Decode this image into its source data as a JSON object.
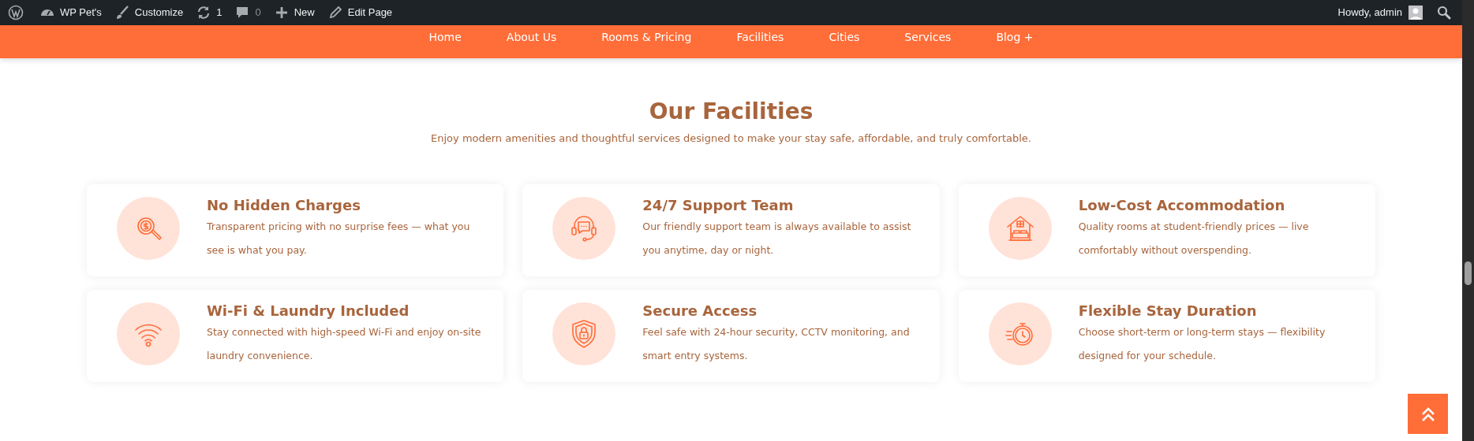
{
  "admin_bar": {
    "items": [
      {
        "kind": "logo"
      },
      {
        "kind": "site",
        "label": "WP Pet's"
      },
      {
        "kind": "customize",
        "label": "Customize"
      },
      {
        "kind": "updates",
        "label": "1"
      },
      {
        "kind": "comments",
        "label": "0"
      },
      {
        "kind": "new",
        "label": "New"
      },
      {
        "kind": "edit",
        "label": "Edit Page"
      }
    ],
    "greeting": "Howdy, admin"
  },
  "nav": {
    "items": [
      "Home",
      "About Us",
      "Rooms & Pricing",
      "Facilities",
      "Cities",
      "Services",
      "Blog +"
    ]
  },
  "section": {
    "title": "Our Facilities",
    "subtitle": "Enjoy modern amenities and thoughtful services designed to make your stay safe, affordable, and truly comfortable."
  },
  "cards": [
    {
      "title": "No Hidden Charges",
      "text": "Transparent pricing with no surprise fees — what you see is what you pay."
    },
    {
      "title": "24/7 Support Team",
      "text": "Our friendly support team is always available to assist you anytime, day or night."
    },
    {
      "title": "Low-Cost Accommodation",
      "text": "Quality rooms at student-friendly prices — live comfortably without overspending."
    },
    {
      "title": "Wi-Fi & Laundry Included",
      "text": "Stay connected with high-speed Wi-Fi and enjoy on-site laundry convenience."
    },
    {
      "title": "Secure Access",
      "text": "Feel safe with 24-hour security, CCTV monitoring, and smart entry systems."
    },
    {
      "title": "Flexible Stay Duration",
      "text": "Choose short-term or long-term stays — flexibility designed for your schedule."
    }
  ]
}
